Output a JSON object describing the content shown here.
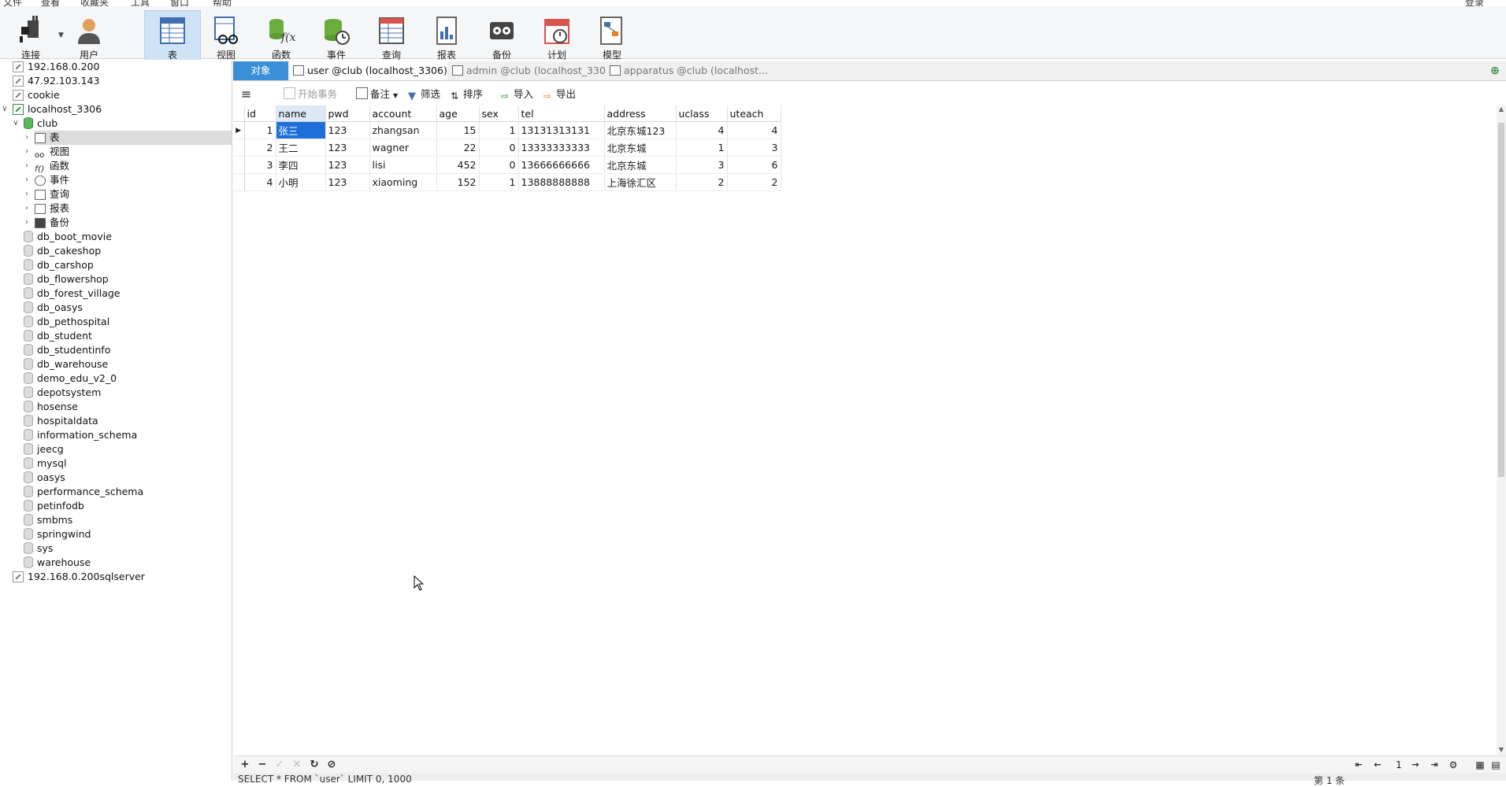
{
  "menu": [
    "文件",
    "查看",
    "收藏夹",
    "工具",
    "窗口",
    "帮助"
  ],
  "menu_right": "登录",
  "toolbar": {
    "buttons": [
      {
        "label": "连接",
        "icon": "plug-icon"
      },
      {
        "label": "用户",
        "icon": "user-icon"
      },
      {
        "label": "表",
        "icon": "table-icon",
        "active": true
      },
      {
        "label": "视图",
        "icon": "view-icon"
      },
      {
        "label": "函数",
        "icon": "function-icon"
      },
      {
        "label": "事件",
        "icon": "event-icon"
      },
      {
        "label": "查询",
        "icon": "query-icon"
      },
      {
        "label": "报表",
        "icon": "report-icon"
      },
      {
        "label": "备份",
        "icon": "backup-icon"
      },
      {
        "label": "计划",
        "icon": "schedule-icon"
      },
      {
        "label": "模型",
        "icon": "model-icon"
      }
    ]
  },
  "sidebar": {
    "connections_top": [
      "192.168.0.200",
      "47.92.103.143",
      "cookie",
      "localhost_3306"
    ],
    "club": "club",
    "club_children": [
      "表",
      "视图",
      "函数",
      "事件",
      "查询",
      "报表",
      "备份"
    ],
    "databases": [
      "db_boot_movie",
      "db_cakeshop",
      "db_carshop",
      "db_flowershop",
      "db_forest_village",
      "db_oasys",
      "db_pethospital",
      "db_student",
      "db_studentinfo",
      "db_warehouse",
      "demo_edu_v2_0",
      "depotsystem",
      "hosense",
      "hospitaldata",
      "information_schema",
      "jeecg",
      "mysql",
      "oasys",
      "performance_schema",
      "petinfodb",
      "smbms",
      "springwind",
      "sys",
      "warehouse"
    ],
    "connection_bottom": "192.168.0.200sqlserver"
  },
  "tabs": {
    "objects": "对象",
    "items": [
      "user @club (localhost_3306)...",
      "admin @club (localhost_330...",
      "apparatus @club (localhost..."
    ]
  },
  "subtoolbar": {
    "begin_transaction": "开始事务",
    "note": "备注",
    "filter": "筛选",
    "sort": "排序",
    "import": "导入",
    "export": "导出"
  },
  "grid": {
    "columns": [
      "id",
      "name",
      "pwd",
      "account",
      "age",
      "sex",
      "tel",
      "address",
      "uclass",
      "uteach"
    ],
    "rows": [
      [
        "1",
        "张三",
        "123",
        "zhangsan",
        "15",
        "1",
        "13131313131",
        "北京东城123",
        "4",
        "4"
      ],
      [
        "2",
        "王二",
        "123",
        "wagner",
        "22",
        "0",
        "13333333333",
        "北京东城",
        "1",
        "3"
      ],
      [
        "3",
        "李四",
        "123",
        "lisi",
        "452",
        "0",
        "13666666666",
        "北京东城",
        "3",
        "6"
      ],
      [
        "4",
        "小明",
        "123",
        "xiaoming",
        "152",
        "1",
        "13888888888",
        "上海徐汇区",
        "2",
        "2"
      ]
    ]
  },
  "pager": {
    "page": "1"
  },
  "status": {
    "sql": "SELECT * FROM `user` LIMIT 0, 1000",
    "record": "第 1 条"
  }
}
